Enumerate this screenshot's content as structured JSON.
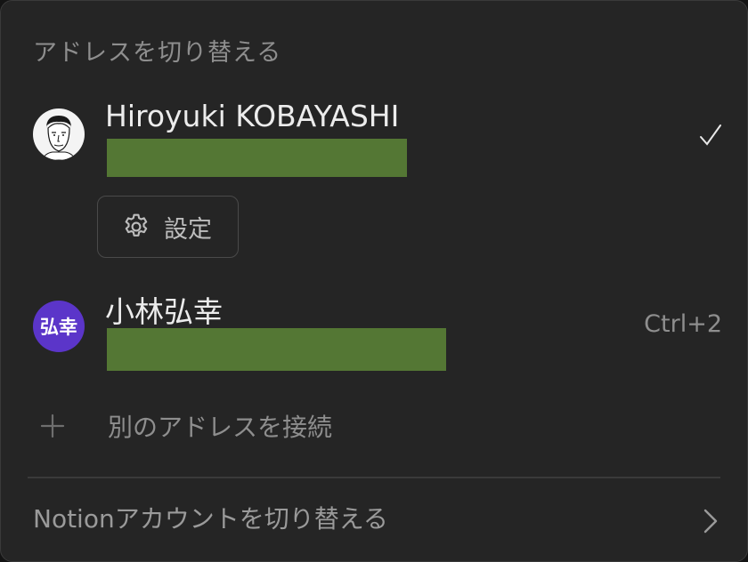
{
  "header": {
    "title": "アドレスを切り替える"
  },
  "accounts": [
    {
      "name": "Hiroyuki KOBAYASHI",
      "avatar": "face-illustration",
      "selected": true,
      "settings_label": "設定"
    },
    {
      "name": "小林弘幸",
      "avatar_initials": "弘幸",
      "avatar_color": "#5b35c9",
      "shortcut": "Ctrl+2",
      "selected": false
    }
  ],
  "add_account": {
    "label": "別のアドレスを接続",
    "icon": "plus-icon"
  },
  "footer": {
    "label": "Notionアカウントを切り替える",
    "icon": "chevron-right-icon"
  },
  "colors": {
    "panel": "#252525",
    "redaction": "#547734",
    "text": "#ececec",
    "muted": "#8e8e8e"
  }
}
